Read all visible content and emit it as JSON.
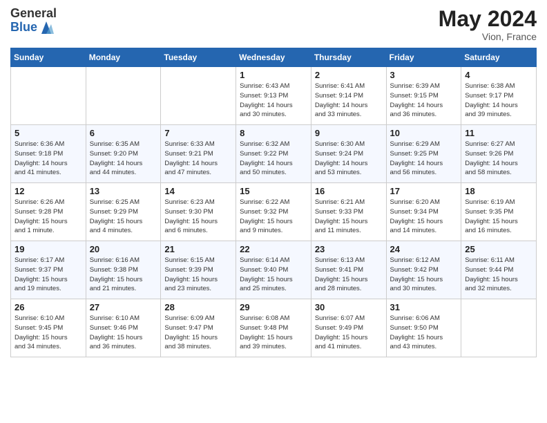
{
  "header": {
    "logo_general": "General",
    "logo_blue": "Blue",
    "month": "May 2024",
    "location": "Vion, France"
  },
  "days_of_week": [
    "Sunday",
    "Monday",
    "Tuesday",
    "Wednesday",
    "Thursday",
    "Friday",
    "Saturday"
  ],
  "weeks": [
    {
      "cells": [
        {
          "day": "",
          "info": ""
        },
        {
          "day": "",
          "info": ""
        },
        {
          "day": "",
          "info": ""
        },
        {
          "day": "1",
          "info": "Sunrise: 6:43 AM\nSunset: 9:13 PM\nDaylight: 14 hours\nand 30 minutes."
        },
        {
          "day": "2",
          "info": "Sunrise: 6:41 AM\nSunset: 9:14 PM\nDaylight: 14 hours\nand 33 minutes."
        },
        {
          "day": "3",
          "info": "Sunrise: 6:39 AM\nSunset: 9:15 PM\nDaylight: 14 hours\nand 36 minutes."
        },
        {
          "day": "4",
          "info": "Sunrise: 6:38 AM\nSunset: 9:17 PM\nDaylight: 14 hours\nand 39 minutes."
        }
      ]
    },
    {
      "cells": [
        {
          "day": "5",
          "info": "Sunrise: 6:36 AM\nSunset: 9:18 PM\nDaylight: 14 hours\nand 41 minutes."
        },
        {
          "day": "6",
          "info": "Sunrise: 6:35 AM\nSunset: 9:20 PM\nDaylight: 14 hours\nand 44 minutes."
        },
        {
          "day": "7",
          "info": "Sunrise: 6:33 AM\nSunset: 9:21 PM\nDaylight: 14 hours\nand 47 minutes."
        },
        {
          "day": "8",
          "info": "Sunrise: 6:32 AM\nSunset: 9:22 PM\nDaylight: 14 hours\nand 50 minutes."
        },
        {
          "day": "9",
          "info": "Sunrise: 6:30 AM\nSunset: 9:24 PM\nDaylight: 14 hours\nand 53 minutes."
        },
        {
          "day": "10",
          "info": "Sunrise: 6:29 AM\nSunset: 9:25 PM\nDaylight: 14 hours\nand 56 minutes."
        },
        {
          "day": "11",
          "info": "Sunrise: 6:27 AM\nSunset: 9:26 PM\nDaylight: 14 hours\nand 58 minutes."
        }
      ]
    },
    {
      "cells": [
        {
          "day": "12",
          "info": "Sunrise: 6:26 AM\nSunset: 9:28 PM\nDaylight: 15 hours\nand 1 minute."
        },
        {
          "day": "13",
          "info": "Sunrise: 6:25 AM\nSunset: 9:29 PM\nDaylight: 15 hours\nand 4 minutes."
        },
        {
          "day": "14",
          "info": "Sunrise: 6:23 AM\nSunset: 9:30 PM\nDaylight: 15 hours\nand 6 minutes."
        },
        {
          "day": "15",
          "info": "Sunrise: 6:22 AM\nSunset: 9:32 PM\nDaylight: 15 hours\nand 9 minutes."
        },
        {
          "day": "16",
          "info": "Sunrise: 6:21 AM\nSunset: 9:33 PM\nDaylight: 15 hours\nand 11 minutes."
        },
        {
          "day": "17",
          "info": "Sunrise: 6:20 AM\nSunset: 9:34 PM\nDaylight: 15 hours\nand 14 minutes."
        },
        {
          "day": "18",
          "info": "Sunrise: 6:19 AM\nSunset: 9:35 PM\nDaylight: 15 hours\nand 16 minutes."
        }
      ]
    },
    {
      "cells": [
        {
          "day": "19",
          "info": "Sunrise: 6:17 AM\nSunset: 9:37 PM\nDaylight: 15 hours\nand 19 minutes."
        },
        {
          "day": "20",
          "info": "Sunrise: 6:16 AM\nSunset: 9:38 PM\nDaylight: 15 hours\nand 21 minutes."
        },
        {
          "day": "21",
          "info": "Sunrise: 6:15 AM\nSunset: 9:39 PM\nDaylight: 15 hours\nand 23 minutes."
        },
        {
          "day": "22",
          "info": "Sunrise: 6:14 AM\nSunset: 9:40 PM\nDaylight: 15 hours\nand 25 minutes."
        },
        {
          "day": "23",
          "info": "Sunrise: 6:13 AM\nSunset: 9:41 PM\nDaylight: 15 hours\nand 28 minutes."
        },
        {
          "day": "24",
          "info": "Sunrise: 6:12 AM\nSunset: 9:42 PM\nDaylight: 15 hours\nand 30 minutes."
        },
        {
          "day": "25",
          "info": "Sunrise: 6:11 AM\nSunset: 9:44 PM\nDaylight: 15 hours\nand 32 minutes."
        }
      ]
    },
    {
      "cells": [
        {
          "day": "26",
          "info": "Sunrise: 6:10 AM\nSunset: 9:45 PM\nDaylight: 15 hours\nand 34 minutes."
        },
        {
          "day": "27",
          "info": "Sunrise: 6:10 AM\nSunset: 9:46 PM\nDaylight: 15 hours\nand 36 minutes."
        },
        {
          "day": "28",
          "info": "Sunrise: 6:09 AM\nSunset: 9:47 PM\nDaylight: 15 hours\nand 38 minutes."
        },
        {
          "day": "29",
          "info": "Sunrise: 6:08 AM\nSunset: 9:48 PM\nDaylight: 15 hours\nand 39 minutes."
        },
        {
          "day": "30",
          "info": "Sunrise: 6:07 AM\nSunset: 9:49 PM\nDaylight: 15 hours\nand 41 minutes."
        },
        {
          "day": "31",
          "info": "Sunrise: 6:06 AM\nSunset: 9:50 PM\nDaylight: 15 hours\nand 43 minutes."
        },
        {
          "day": "",
          "info": ""
        }
      ]
    }
  ]
}
